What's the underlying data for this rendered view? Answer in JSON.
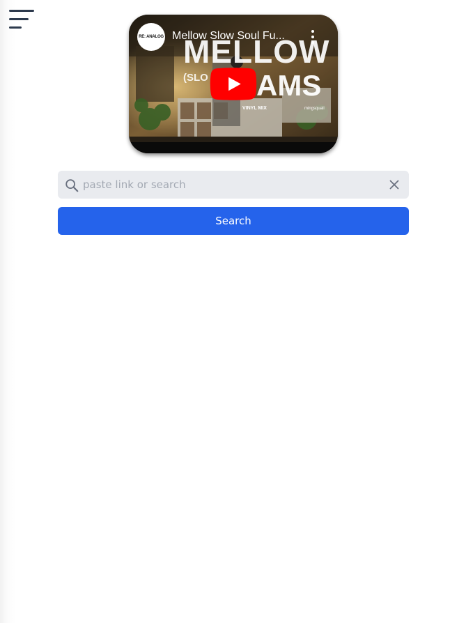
{
  "menu": {
    "icon": "hamburger-menu-icon"
  },
  "video": {
    "title": "Mellow Slow Soul Fu...",
    "channel_avatar_text": "RE: ANALOG",
    "thumbnail_text": {
      "line1": "MELLOW",
      "line2": "AMS",
      "line3": "(SLO",
      "tag": "VINYL MIX",
      "credit": "mingsquall"
    },
    "play_icon": "youtube-play-icon",
    "more_icon": "more-vertical-icon"
  },
  "search": {
    "icon": "search-icon",
    "placeholder": "paste link or search",
    "value": "",
    "clear_icon": "close-icon",
    "button_label": "Search"
  },
  "colors": {
    "accent": "#2563eb",
    "input_bg": "#e9ebef",
    "menu_icon": "#2d3a4d",
    "youtube_red": "#ff0000"
  }
}
